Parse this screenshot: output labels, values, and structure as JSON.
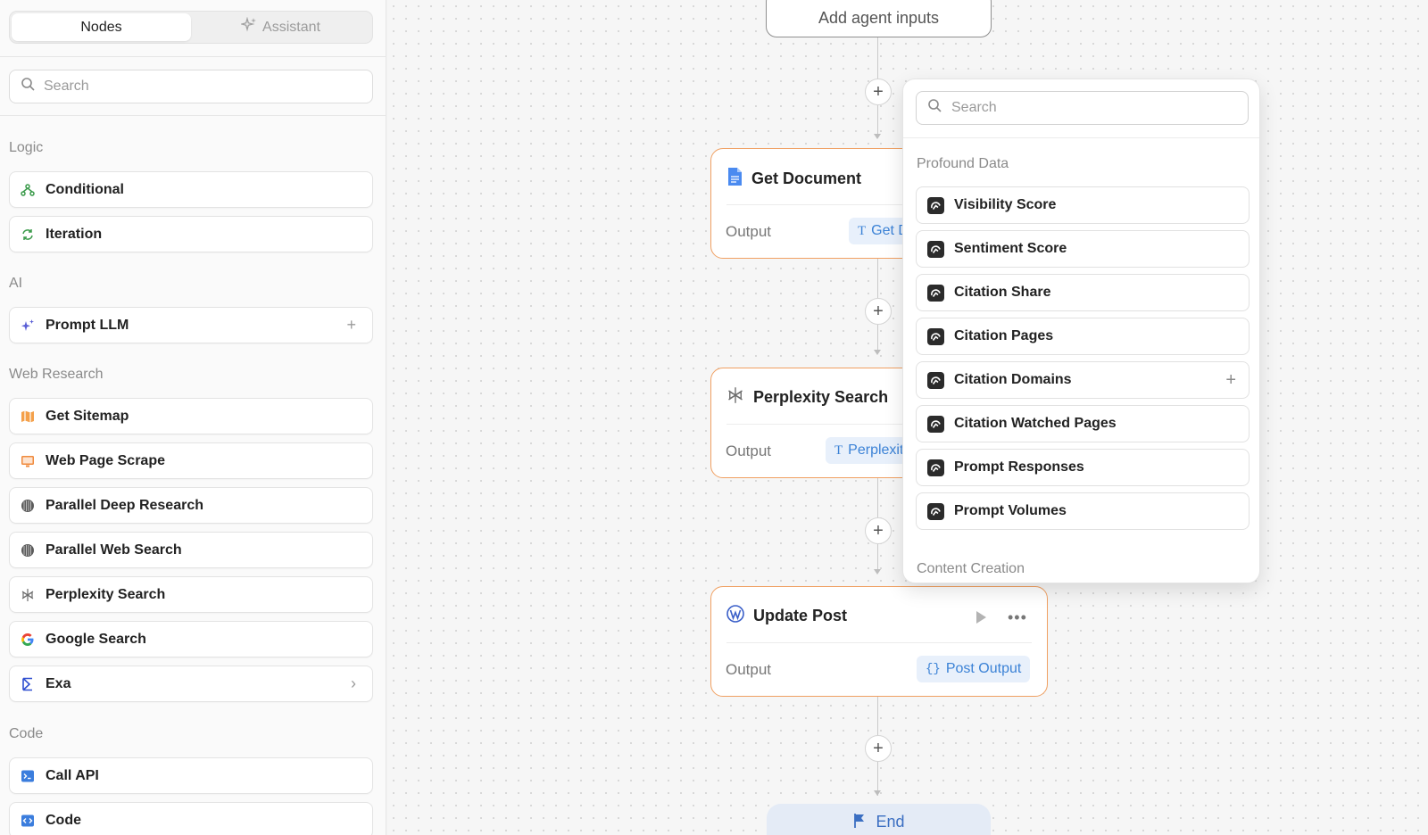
{
  "sidebar": {
    "tabs": [
      {
        "label": "Nodes",
        "active": true
      },
      {
        "label": "Assistant",
        "active": false
      }
    ],
    "search_placeholder": "Search",
    "sections": [
      {
        "title": "Logic",
        "items": [
          {
            "label": "Conditional",
            "icon": "branch-icon"
          },
          {
            "label": "Iteration",
            "icon": "loop-icon"
          }
        ]
      },
      {
        "title": "AI",
        "items": [
          {
            "label": "Prompt LLM",
            "icon": "sparkle-icon",
            "trail": "+"
          }
        ]
      },
      {
        "title": "Web Research",
        "items": [
          {
            "label": "Get Sitemap",
            "icon": "map-icon"
          },
          {
            "label": "Web Page Scrape",
            "icon": "monitor-icon"
          },
          {
            "label": "Parallel Deep Research",
            "icon": "parallel-icon"
          },
          {
            "label": "Parallel Web Search",
            "icon": "parallel-icon"
          },
          {
            "label": "Perplexity Search",
            "icon": "perplexity-icon"
          },
          {
            "label": "Google Search",
            "icon": "google-icon"
          },
          {
            "label": "Exa",
            "icon": "exa-icon",
            "trail": "›"
          }
        ]
      },
      {
        "title": "Code",
        "items": [
          {
            "label": "Call API",
            "icon": "terminal-icon"
          },
          {
            "label": "Code",
            "icon": "code-icon"
          }
        ]
      }
    ]
  },
  "canvas": {
    "start_node": {
      "label": "Add agent inputs"
    },
    "nodes": [
      {
        "title": "Get Document",
        "icon": "document-icon",
        "output_label": "Output",
        "chip": "Get D"
      },
      {
        "title": "Perplexity Search",
        "icon": "perplexity-icon",
        "output_label": "Output",
        "chip": "Perplexity"
      },
      {
        "title": "Update Post",
        "icon": "wordpress-icon",
        "output_label": "Output",
        "chip": "Post Output"
      }
    ],
    "end_node": {
      "label": "End"
    }
  },
  "popup": {
    "search_placeholder": "Search",
    "groups": [
      {
        "title": "Profound Data",
        "items": [
          "Visibility Score",
          "Sentiment Score",
          "Citation Share",
          "Citation Pages",
          "Citation Domains",
          "Citation Watched Pages",
          "Prompt Responses",
          "Prompt Volumes"
        ]
      },
      {
        "title": "Content Creation",
        "items": []
      }
    ],
    "hover_item_trail": "+"
  },
  "colors": {
    "node_border": "#f0a062",
    "chip_bg": "#e8f0fb",
    "chip_text": "#3b82d6",
    "end_bg": "#e4ebf6"
  }
}
